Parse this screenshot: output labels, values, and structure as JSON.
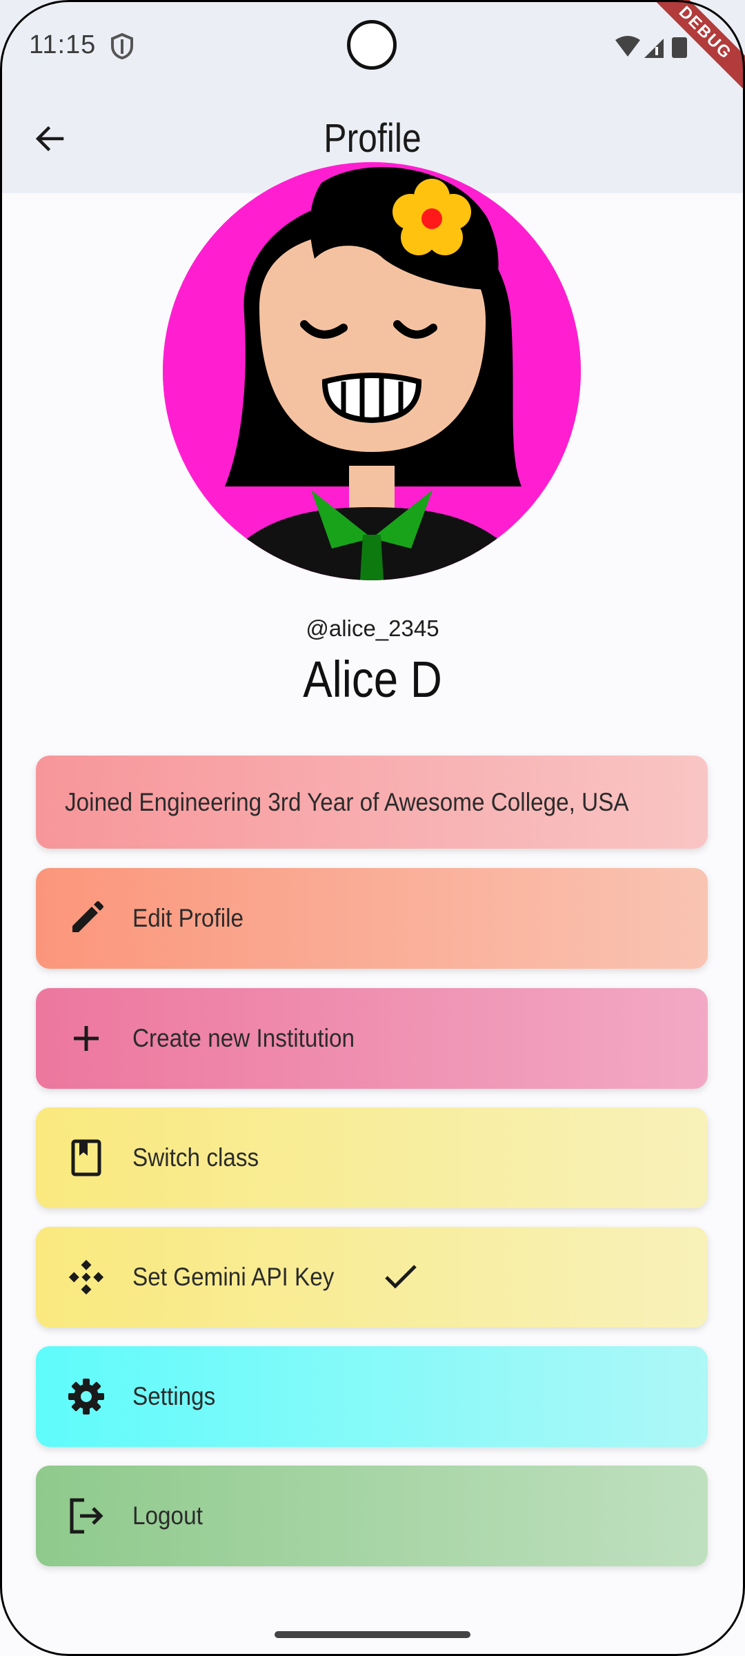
{
  "status_bar": {
    "time": "11:15",
    "debug_badge": "DEBUG"
  },
  "app_bar": {
    "title": "Profile"
  },
  "profile": {
    "username": "@alice_2345",
    "display_name": "Alice D",
    "info": "Joined Engineering 3rd Year of Awesome College, USA"
  },
  "actions": {
    "edit_profile": "Edit Profile",
    "create_institution": "Create new Institution",
    "switch_class": "Switch class",
    "set_api_key": "Set Gemini API Key",
    "settings": "Settings",
    "logout": "Logout"
  },
  "icons": {
    "back": "arrow-back-icon",
    "edit": "pencil-icon",
    "create": "plus-icon",
    "switch": "book-icon",
    "api_key": "gemini-diamond-icon",
    "api_key_status": "check-icon",
    "settings": "gear-icon",
    "logout": "logout-icon"
  },
  "colors": {
    "app_bar_bg": "#eceef5",
    "avatar_bg": "#ff1fd0",
    "info_card": "#f7969a",
    "edit_card": "#fb967b",
    "institution_card": "#ed779e",
    "class_card": "#f9e97e",
    "api_card": "#f9e97e",
    "settings_card": "#5ffbfb",
    "logout_card": "#8fca8c"
  }
}
